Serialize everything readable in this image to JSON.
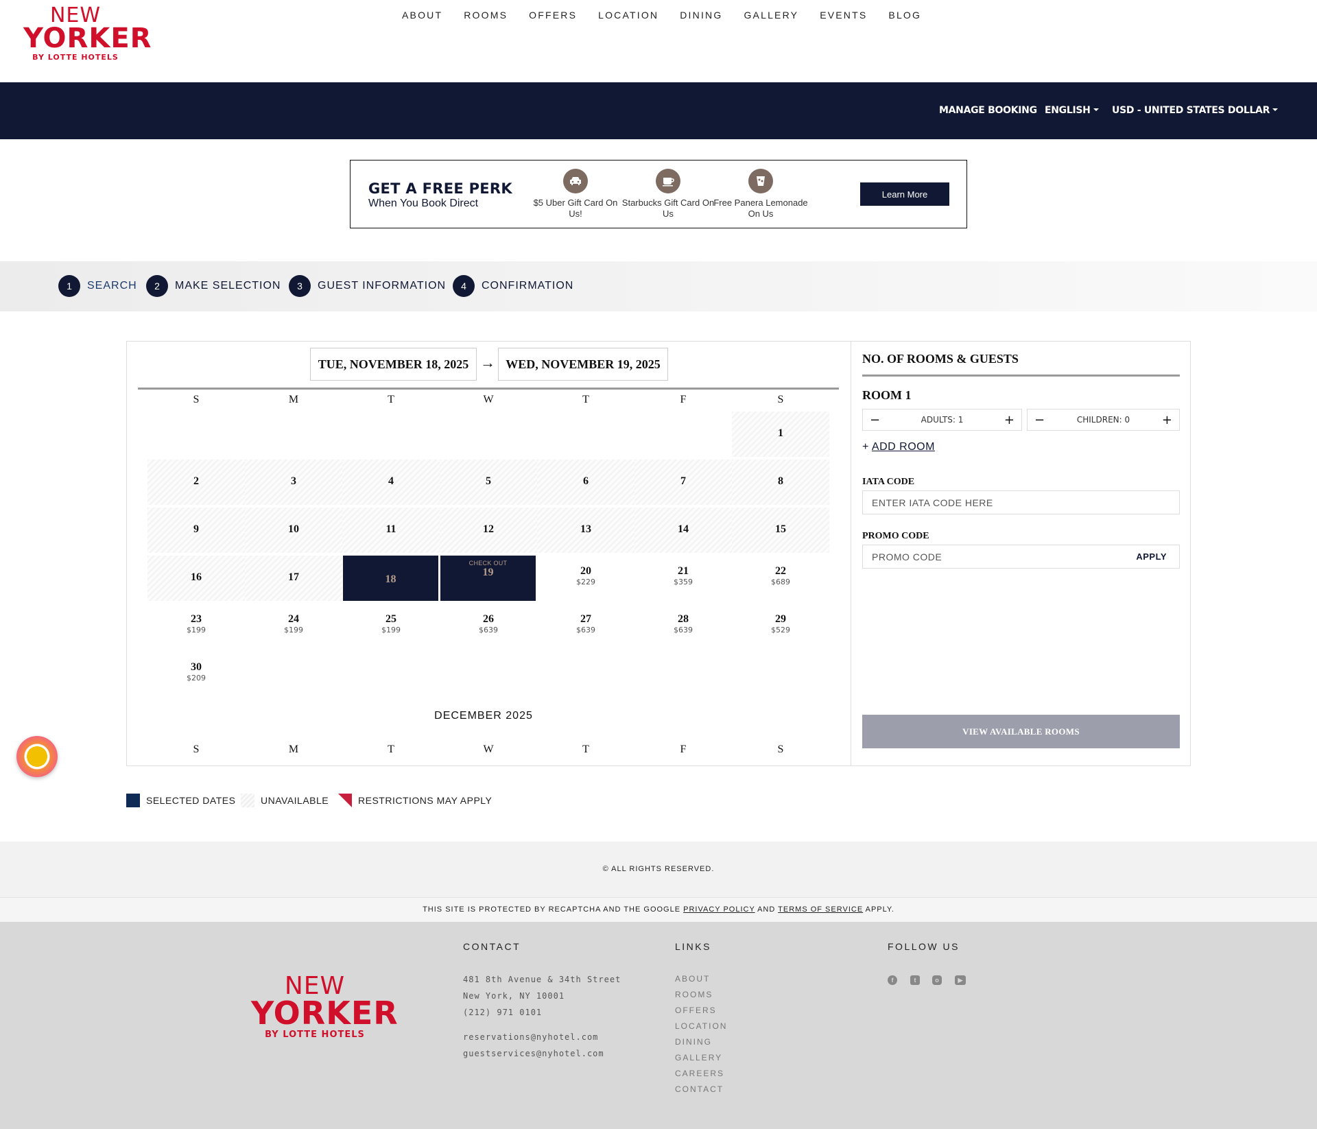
{
  "brand": {
    "line1": "NEW",
    "line2": "YORKER",
    "line3": "BY LOTTE HOTELS"
  },
  "nav": [
    "ABOUT",
    "ROOMS",
    "OFFERS",
    "LOCATION",
    "DINING",
    "GALLERY",
    "EVENTS",
    "BLOG"
  ],
  "topbar": {
    "manage": "MANAGE BOOKING",
    "language": "ENGLISH",
    "currency": "USD - UNITED STATES DOLLAR"
  },
  "perk": {
    "title": "GET A FREE PERK",
    "subtitle": "When You Book Direct",
    "items": [
      "$5 Uber Gift Card On Us!",
      "Starbucks Gift Card On Us",
      "Free Panera Lemonade On Us"
    ],
    "button": "Learn More"
  },
  "steps": [
    {
      "n": "1",
      "label": "SEARCH"
    },
    {
      "n": "2",
      "label": "MAKE SELECTION"
    },
    {
      "n": "3",
      "label": "GUEST INFORMATION"
    },
    {
      "n": "4",
      "label": "CONFIRMATION"
    }
  ],
  "dates": {
    "checkin": "TUE, NOVEMBER 18, 2025",
    "checkout": "WED, NOVEMBER 19, 2025",
    "arrow": "→"
  },
  "weekdays": [
    "S",
    "M",
    "T",
    "W",
    "T",
    "F",
    "S"
  ],
  "calendar": {
    "checkout_label": "CHECK OUT",
    "days": [
      {
        "d": "1",
        "s": "un",
        "p": ""
      },
      {
        "d": "2",
        "s": "un",
        "p": ""
      },
      {
        "d": "3",
        "s": "un",
        "p": ""
      },
      {
        "d": "4",
        "s": "un",
        "p": ""
      },
      {
        "d": "5",
        "s": "un",
        "p": ""
      },
      {
        "d": "6",
        "s": "un",
        "p": ""
      },
      {
        "d": "7",
        "s": "un",
        "p": ""
      },
      {
        "d": "8",
        "s": "un",
        "p": ""
      },
      {
        "d": "9",
        "s": "un",
        "p": ""
      },
      {
        "d": "10",
        "s": "un",
        "p": ""
      },
      {
        "d": "11",
        "s": "un",
        "p": ""
      },
      {
        "d": "12",
        "s": "un",
        "p": ""
      },
      {
        "d": "13",
        "s": "un",
        "p": ""
      },
      {
        "d": "14",
        "s": "un",
        "p": ""
      },
      {
        "d": "15",
        "s": "un",
        "p": ""
      },
      {
        "d": "16",
        "s": "un",
        "p": ""
      },
      {
        "d": "17",
        "s": "un",
        "p": ""
      },
      {
        "d": "18",
        "s": "sel",
        "p": ""
      },
      {
        "d": "19",
        "s": "sel-co",
        "p": ""
      },
      {
        "d": "20",
        "s": "av",
        "p": "$229"
      },
      {
        "d": "21",
        "s": "av",
        "p": "$359"
      },
      {
        "d": "22",
        "s": "av",
        "p": "$689"
      },
      {
        "d": "23",
        "s": "av",
        "p": "$199"
      },
      {
        "d": "24",
        "s": "av",
        "p": "$199"
      },
      {
        "d": "25",
        "s": "av",
        "p": "$199"
      },
      {
        "d": "26",
        "s": "av",
        "p": "$639"
      },
      {
        "d": "27",
        "s": "av",
        "p": "$639"
      },
      {
        "d": "28",
        "s": "av",
        "p": "$639"
      },
      {
        "d": "29",
        "s": "av",
        "p": "$529"
      },
      {
        "d": "30",
        "s": "av",
        "p": "$209"
      }
    ],
    "next_month": "DECEMBER 2025"
  },
  "guests": {
    "title": "NO. OF ROOMS & GUESTS",
    "room": "ROOM 1",
    "adults": "ADULTS: 1",
    "children": "CHILDREN: 0",
    "minus": "−",
    "plus": "+",
    "add_room": "ADD ROOM",
    "add_plus": "+"
  },
  "iata": {
    "label": "IATA CODE",
    "placeholder": "ENTER IATA CODE HERE"
  },
  "promo": {
    "label": "PROMO CODE",
    "placeholder": "PROMO CODE",
    "apply": "APPLY"
  },
  "view_button": "VIEW AVAILABLE ROOMS",
  "legend": {
    "selected": "SELECTED DATES",
    "unavailable": "UNAVAILABLE",
    "restrictions": "RESTRICTIONS MAY APPLY"
  },
  "colors": {
    "navy": "#111833",
    "brand_red": "#d0102a",
    "restriction_red": "#c8203c",
    "selected_swatch": "#0f2a55"
  },
  "footer": {
    "rights": "© ALL RIGHTS RESERVED.",
    "recaptcha_pre": "THIS SITE IS PROTECTED BY RECAPTCHA AND THE GOOGLE",
    "privacy": "PRIVACY POLICY",
    "and": "AND",
    "terms": "TERMS OF SERVICE",
    "apply": "APPLY.",
    "contact_head": "CONTACT",
    "contact": [
      "481 8th Avenue & 34th Street",
      "New York, NY 10001",
      "(212) 971 0101",
      "reservations@nyhotel.com",
      "guestservices@nyhotel.com"
    ],
    "links_head": "LINKS",
    "links": [
      "ABOUT",
      "ROOMS",
      "OFFERS",
      "LOCATION",
      "DINING",
      "GALLERY",
      "CAREERS",
      "CONTACT"
    ],
    "follow_head": "FOLLOW US",
    "social": [
      "facebook-icon",
      "twitter-icon",
      "instagram-icon",
      "youtube-icon"
    ]
  }
}
